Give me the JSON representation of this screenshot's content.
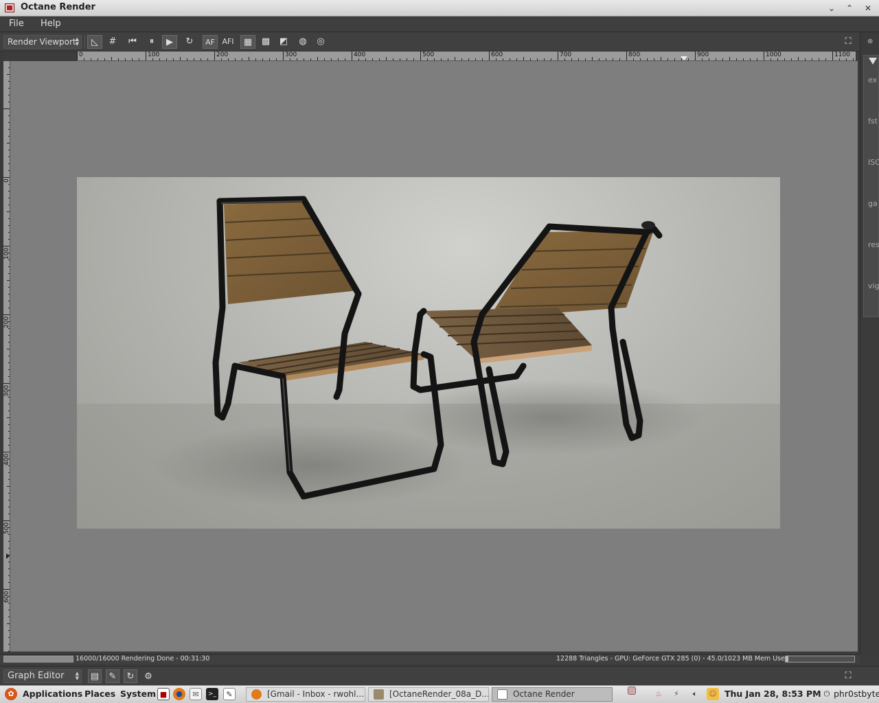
{
  "window": {
    "title": "Octane Render",
    "controls": [
      "minimize-icon",
      "maximize-icon",
      "close-icon"
    ]
  },
  "menubar": {
    "items": [
      "File",
      "Help"
    ]
  },
  "toolbar": {
    "viewport_select": "Render Viewport",
    "buttons": [
      {
        "name": "select-tool-icon",
        "glyph": "◺"
      },
      {
        "name": "grid-tool-icon",
        "glyph": "#"
      },
      {
        "name": "skip-back-icon",
        "glyph": "⏮"
      },
      {
        "name": "pause-icon",
        "glyph": "⏸"
      },
      {
        "name": "play-icon",
        "glyph": "▶"
      },
      {
        "name": "refresh-icon",
        "glyph": "↻"
      },
      {
        "name": "autofocus-icon",
        "glyph": "AF"
      },
      {
        "name": "autofocus-picker-icon",
        "glyph": "AFI"
      },
      {
        "name": "region-icon",
        "glyph": "▦"
      },
      {
        "name": "checker-icon",
        "glyph": "▩"
      },
      {
        "name": "alpha-icon",
        "glyph": "◩"
      },
      {
        "name": "camera-target-icon",
        "glyph": "◍"
      },
      {
        "name": "camera-reset-icon",
        "glyph": "◎"
      }
    ],
    "fullscreen_icon": "fullscreen-icon"
  },
  "ruler": {
    "horizontal_labels": [
      "0",
      "100",
      "200",
      "300",
      "400",
      "500",
      "600",
      "700",
      "800",
      "900",
      "1000",
      "1100"
    ],
    "vertical_labels": [
      "0",
      "100",
      "200",
      "300",
      "400",
      "500",
      "600"
    ]
  },
  "right_panel": {
    "labels": [
      "ex",
      "fst",
      "ISO",
      "ga",
      "res",
      "vig"
    ]
  },
  "status": {
    "left": "16000/16000 Rendering Done - 00:31:30",
    "right": "12288 Triangles - GPU: GeForce GTX 285 (0) - 45.0/1023 MB Mem Used",
    "render_progress": 1.0,
    "memory_fraction": 0.044
  },
  "graph_editor": {
    "select": "Graph Editor",
    "buttons": [
      "node-add-icon",
      "node-graph-icon",
      "node-refresh-icon",
      "node-tool-icon"
    ]
  },
  "taskbar": {
    "menus": [
      "Applications",
      "Places",
      "System"
    ],
    "tasks": [
      {
        "label": "[Gmail - Inbox - rwohl...",
        "active": false
      },
      {
        "label": "[OctaneRender_08a_D...",
        "active": false
      },
      {
        "label": "Octane Render",
        "active": true
      }
    ],
    "clock": "Thu Jan 28,  8:53 PM",
    "user": "phr0stbyte"
  },
  "colors": {
    "viewport_bg": "#7e7e7e",
    "panel_bg": "#404040",
    "accent_red": "#b02020"
  }
}
